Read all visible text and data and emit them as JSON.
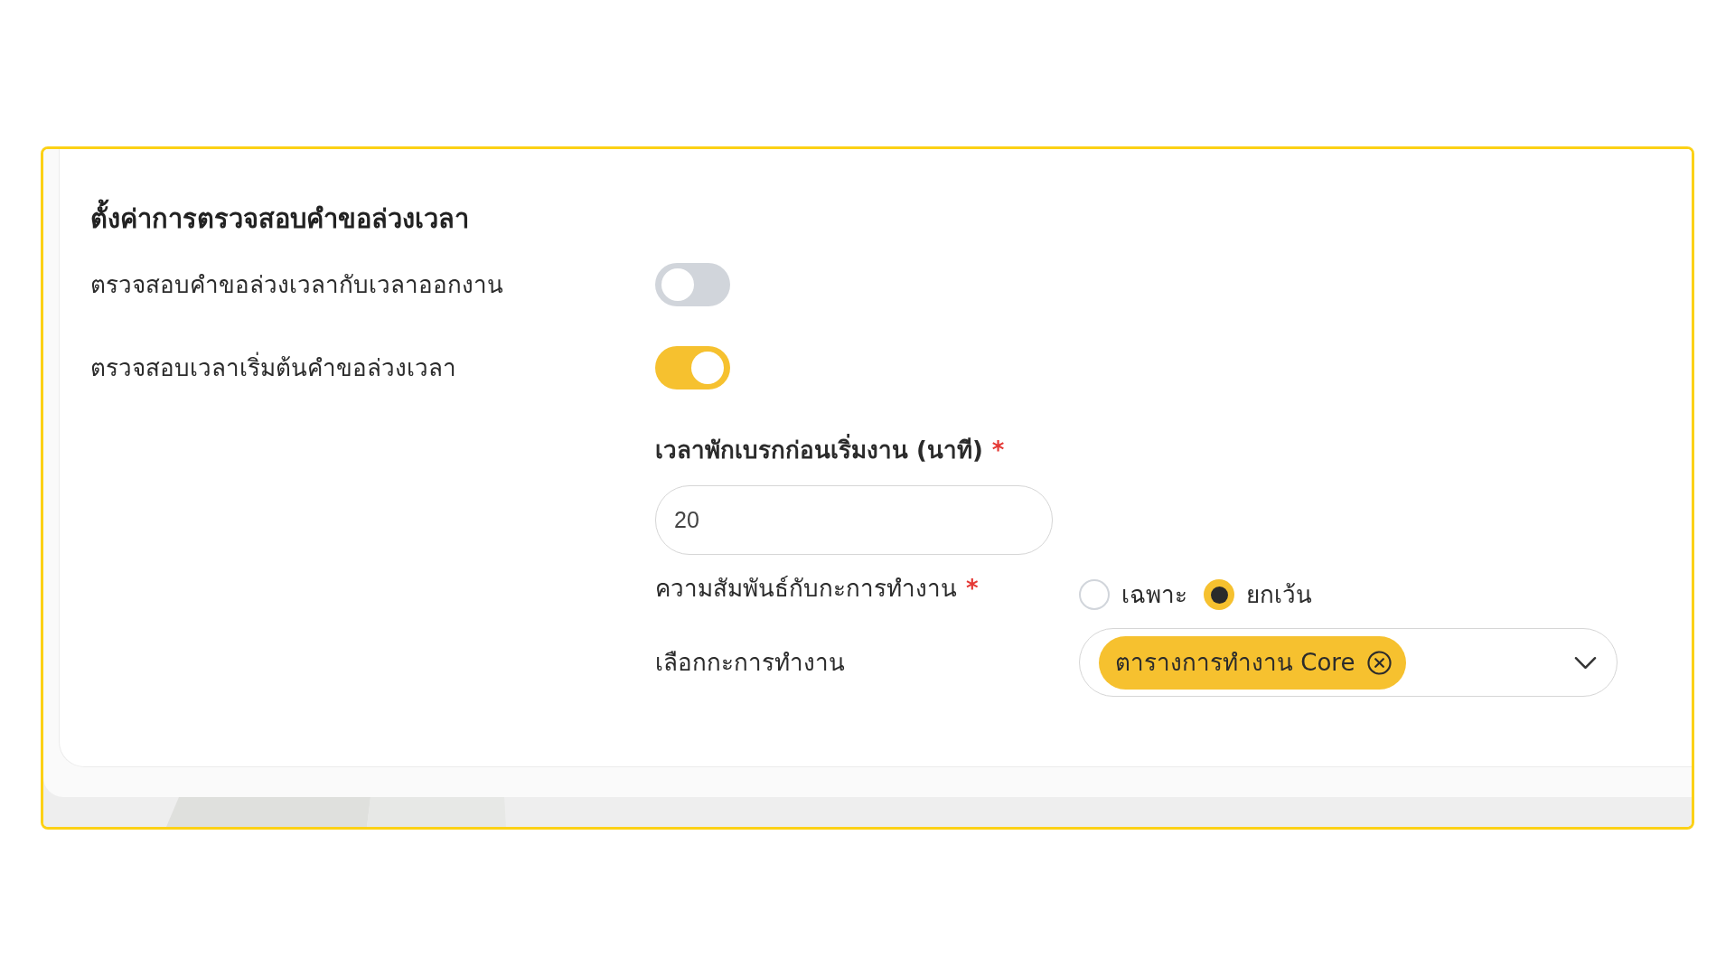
{
  "section": {
    "title": "ตั้งค่าการตรวจสอบคำขอล่วงเวลา",
    "toggles": [
      {
        "label": "ตรวจสอบคำขอล่วงเวลากับเวลาออกงาน",
        "on": false
      },
      {
        "label": "ตรวจสอบเวลาเริ่มต้นคำขอล่วงเวลา",
        "on": true
      }
    ],
    "break_time": {
      "label": "เวลาพักเบรกก่อนเริ่มงาน (นาที)",
      "required_mark": "*",
      "value": "20"
    },
    "shift_relation": {
      "label": "ความสัมพันธ์กับกะการทำงาน",
      "required_mark": "*",
      "options": [
        {
          "label": "เฉพาะ",
          "selected": false
        },
        {
          "label": "ยกเว้น",
          "selected": true
        }
      ]
    },
    "shift_select": {
      "label": "เลือกกะการทำงาน",
      "chips": [
        {
          "label": "ตารางการทำงาน Core"
        }
      ]
    }
  }
}
